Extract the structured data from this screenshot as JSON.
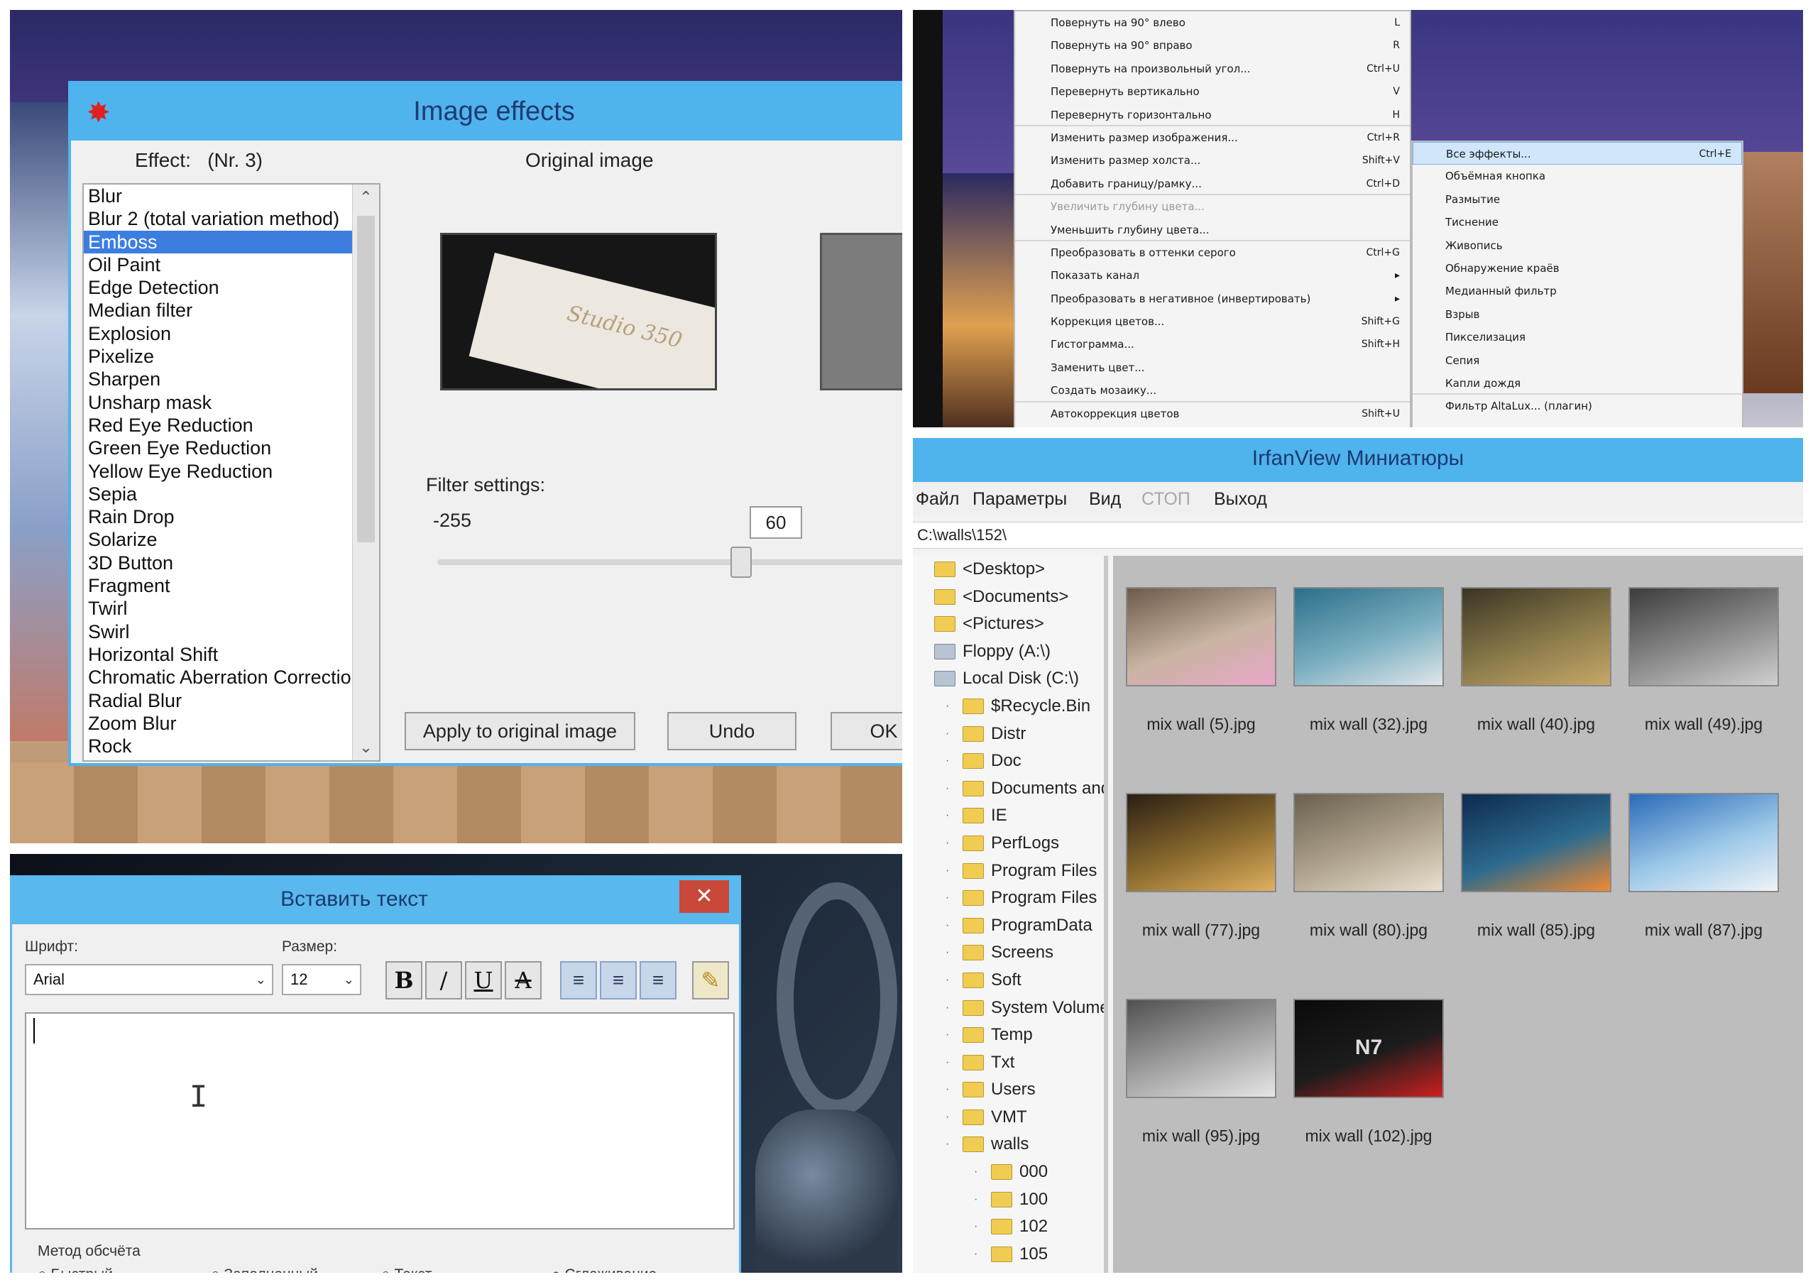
{
  "effects_dialog": {
    "title": "Image effects",
    "effect_label": "Effect:",
    "effect_number": "(Nr. 3)",
    "original_label": "Original image",
    "effects": [
      "Blur",
      "Blur 2 (total variation method)",
      "Emboss",
      "Oil Paint",
      "Edge Detection",
      "Median filter",
      "Explosion",
      "Pixelize",
      "Sharpen",
      "Unsharp mask",
      "Red Eye Reduction",
      "Green Eye Reduction",
      "Yellow Eye Reduction",
      "Sepia",
      "Rain Drop",
      "Solarize",
      "3D Button",
      "Fragment",
      "Twirl",
      "Swirl",
      "Horizontal Shift",
      "Chromatic Aberration Correction",
      "Radial Blur",
      "Zoom Blur",
      "Rock"
    ],
    "selected_effect": "Emboss",
    "preview_text": "Studio 350",
    "filter_settings_label": "Filter settings:",
    "slider_min": "-255",
    "slider_value": "60",
    "slider_fill": 0.62,
    "apply_button": "Apply to original image",
    "undo_button": "Undo",
    "ok_button": "OK"
  },
  "image_menu": {
    "items": [
      {
        "label": "Повернуть на 90° влево",
        "shortcut": "L"
      },
      {
        "label": "Повернуть на 90° вправо",
        "shortcut": "R"
      },
      {
        "label": "Повернуть на произвольный угол...",
        "shortcut": "Ctrl+U"
      },
      {
        "label": "Перевернуть вертикально",
        "shortcut": "V"
      },
      {
        "label": "Перевернуть горизонтально",
        "shortcut": "H",
        "separator": true
      },
      {
        "label": "Изменить размер изображения...",
        "shortcut": "Ctrl+R"
      },
      {
        "label": "Изменить размер холста...",
        "shortcut": "Shift+V"
      },
      {
        "label": "Добавить границу/рамку...",
        "shortcut": "Ctrl+D",
        "separator": true
      },
      {
        "label": "Увеличить глубину цвета...",
        "shortcut": "",
        "disabled": true
      },
      {
        "label": "Уменьшить глубину цвета...",
        "shortcut": "",
        "separator": true
      },
      {
        "label": "Преобразовать в оттенки серого",
        "shortcut": "Ctrl+G"
      },
      {
        "label": "Показать канал",
        "shortcut": "▸"
      },
      {
        "label": "Преобразовать в негативное (инвертировать)",
        "shortcut": "▸"
      },
      {
        "label": "Коррекция цветов...",
        "shortcut": "Shift+G"
      },
      {
        "label": "Гистограмма...",
        "shortcut": "Shift+H"
      },
      {
        "label": "Заменить цвет...",
        "shortcut": ""
      },
      {
        "label": "Создать мозаику...",
        "shortcut": "",
        "separator": true
      },
      {
        "label": "Автокоррекция цветов",
        "shortcut": "Shift+U"
      }
    ],
    "submenu": [
      {
        "label": "Все эффекты...",
        "shortcut": "Ctrl+E",
        "highlighted": true
      },
      {
        "label": "Объёмная кнопка",
        "shortcut": ""
      },
      {
        "label": "Размытие",
        "shortcut": ""
      },
      {
        "label": "Тиснение",
        "shortcut": ""
      },
      {
        "label": "Живопись",
        "shortcut": ""
      },
      {
        "label": "Обнаружение краёв",
        "shortcut": ""
      },
      {
        "label": "Медианный фильтр",
        "shortcut": ""
      },
      {
        "label": "Взрыв",
        "shortcut": ""
      },
      {
        "label": "Пикселизация",
        "shortcut": ""
      },
      {
        "label": "Сепия",
        "shortcut": ""
      },
      {
        "label": "Капли дождя",
        "shortcut": "",
        "separator": true
      },
      {
        "label": "Фильтр AltaLux... (плагин)",
        "shortcut": ""
      }
    ]
  },
  "text_dialog": {
    "title": "Вставить текст",
    "close": "✕",
    "font_label": "Шрифт:",
    "font_value": "Arial",
    "size_label": "Размер:",
    "size_value": "12",
    "bold": "B",
    "italic": "/",
    "underline": "U",
    "strike": "A",
    "align_left": "≡",
    "align_center": "≡",
    "align_right": "≡",
    "method_label": "Метод обсчёта",
    "radio_1": "Быстрый",
    "radio_2": "Заполненный",
    "radio_3": "Текст",
    "radio_4": "Сглаживание"
  },
  "thumbnails_window": {
    "title": "IrfanView Миниатюры",
    "menu": [
      "Файл",
      "Параметры",
      "Вид",
      "СТОП",
      "Выход"
    ],
    "path": "C:\\walls\\152\\",
    "tree": [
      {
        "label": "<Desktop>",
        "level": 1,
        "drive": false
      },
      {
        "label": "<Documents>",
        "level": 1,
        "drive": false
      },
      {
        "label": "<Pictures>",
        "level": 1,
        "drive": false
      },
      {
        "label": "Floppy (A:\\)",
        "level": 1,
        "drive": true
      },
      {
        "label": "Local Disk (C:\\)",
        "level": 1,
        "drive": true
      },
      {
        "label": "$Recycle.Bin",
        "level": 2,
        "drive": false
      },
      {
        "label": "Distr",
        "level": 2,
        "drive": false
      },
      {
        "label": "Doc",
        "level": 2,
        "drive": false
      },
      {
        "label": "Documents and",
        "level": 2,
        "drive": false
      },
      {
        "label": "IE",
        "level": 2,
        "drive": false
      },
      {
        "label": "PerfLogs",
        "level": 2,
        "drive": false
      },
      {
        "label": "Program Files",
        "level": 2,
        "drive": false
      },
      {
        "label": "Program Files",
        "level": 2,
        "drive": false
      },
      {
        "label": "ProgramData",
        "level": 2,
        "drive": false
      },
      {
        "label": "Screens",
        "level": 2,
        "drive": false
      },
      {
        "label": "Soft",
        "level": 2,
        "drive": false
      },
      {
        "label": "System Volume",
        "level": 2,
        "drive": false
      },
      {
        "label": "Temp",
        "level": 2,
        "drive": false
      },
      {
        "label": "Txt",
        "level": 2,
        "drive": false
      },
      {
        "label": "Users",
        "level": 2,
        "drive": false
      },
      {
        "label": "VMT",
        "level": 2,
        "drive": false
      },
      {
        "label": "walls",
        "level": 2,
        "drive": false
      },
      {
        "label": "000",
        "level": 3,
        "drive": false
      },
      {
        "label": "100",
        "level": 3,
        "drive": false
      },
      {
        "label": "102",
        "level": 3,
        "drive": false
      },
      {
        "label": "105",
        "level": 3,
        "drive": false
      }
    ],
    "thumbnails": [
      {
        "name": "mix wall (5).jpg",
        "colors": [
          "#6e5a4a",
          "#c9b4a2",
          "#e8a6c8"
        ]
      },
      {
        "name": "mix wall (32).jpg",
        "colors": [
          "#2c6f8a",
          "#7aaec0",
          "#dfe6ea"
        ]
      },
      {
        "name": "mix wall (40).jpg",
        "colors": [
          "#3a3424",
          "#8a7a4a",
          "#c6a868"
        ]
      },
      {
        "name": "mix wall (49).jpg",
        "colors": [
          "#3c3c3c",
          "#8c8c8c",
          "#d0d0d0"
        ]
      },
      {
        "name": "mix wall (77).jpg",
        "colors": [
          "#2a1f14",
          "#8a6a2e",
          "#e0b060"
        ]
      },
      {
        "name": "mix wall (80).jpg",
        "colors": [
          "#6a6050",
          "#b0a48c",
          "#e8e0d0"
        ]
      },
      {
        "name": "mix wall (85).jpg",
        "colors": [
          "#0e2a4e",
          "#2c6a8e",
          "#f08a30"
        ]
      },
      {
        "name": "mix wall (87).jpg",
        "colors": [
          "#2a6ab8",
          "#9cc8e8",
          "#f0f4f8"
        ]
      },
      {
        "name": "mix wall (95).jpg",
        "colors": [
          "#505050",
          "#a4a4a4",
          "#e6e6e6"
        ]
      },
      {
        "name": "mix wall (102).jpg",
        "colors": [
          "#0a0a0a",
          "#1c1c1c",
          "#cc2020"
        ],
        "badge": "N7"
      }
    ]
  }
}
